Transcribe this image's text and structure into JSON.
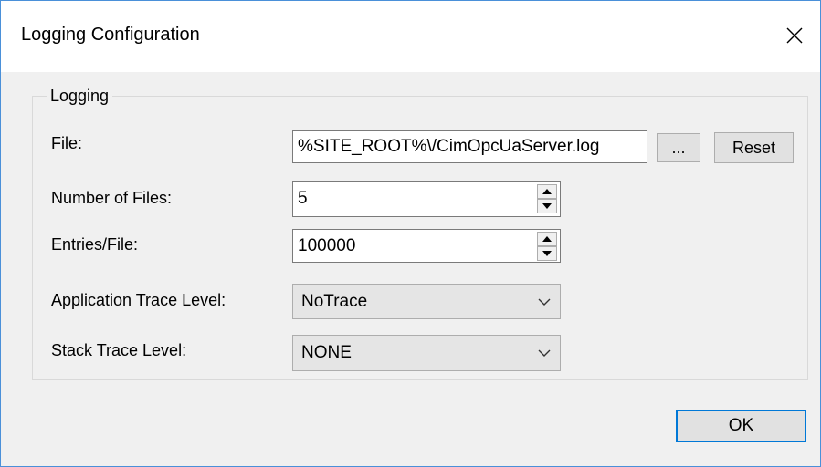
{
  "window": {
    "title": "Logging Configuration",
    "close_icon": "close-icon"
  },
  "group": {
    "legend": "Logging"
  },
  "fields": {
    "file": {
      "label": "File:",
      "value": "%SITE_ROOT%\\/CimOpcUaServer.log",
      "browse_label": "...",
      "reset_label": "Reset"
    },
    "number_of_files": {
      "label": "Number of Files:",
      "value": "5"
    },
    "entries_per_file": {
      "label": "Entries/File:",
      "value": "100000"
    },
    "application_trace_level": {
      "label": "Application Trace Level:",
      "selected": "NoTrace"
    },
    "stack_trace_level": {
      "label": "Stack Trace Level:",
      "selected": "NONE"
    }
  },
  "buttons": {
    "ok_label": "OK"
  },
  "colors": {
    "window_border": "#4a90d9",
    "focus_border": "#0078d7",
    "dialog_bg": "#f0f0f0"
  }
}
